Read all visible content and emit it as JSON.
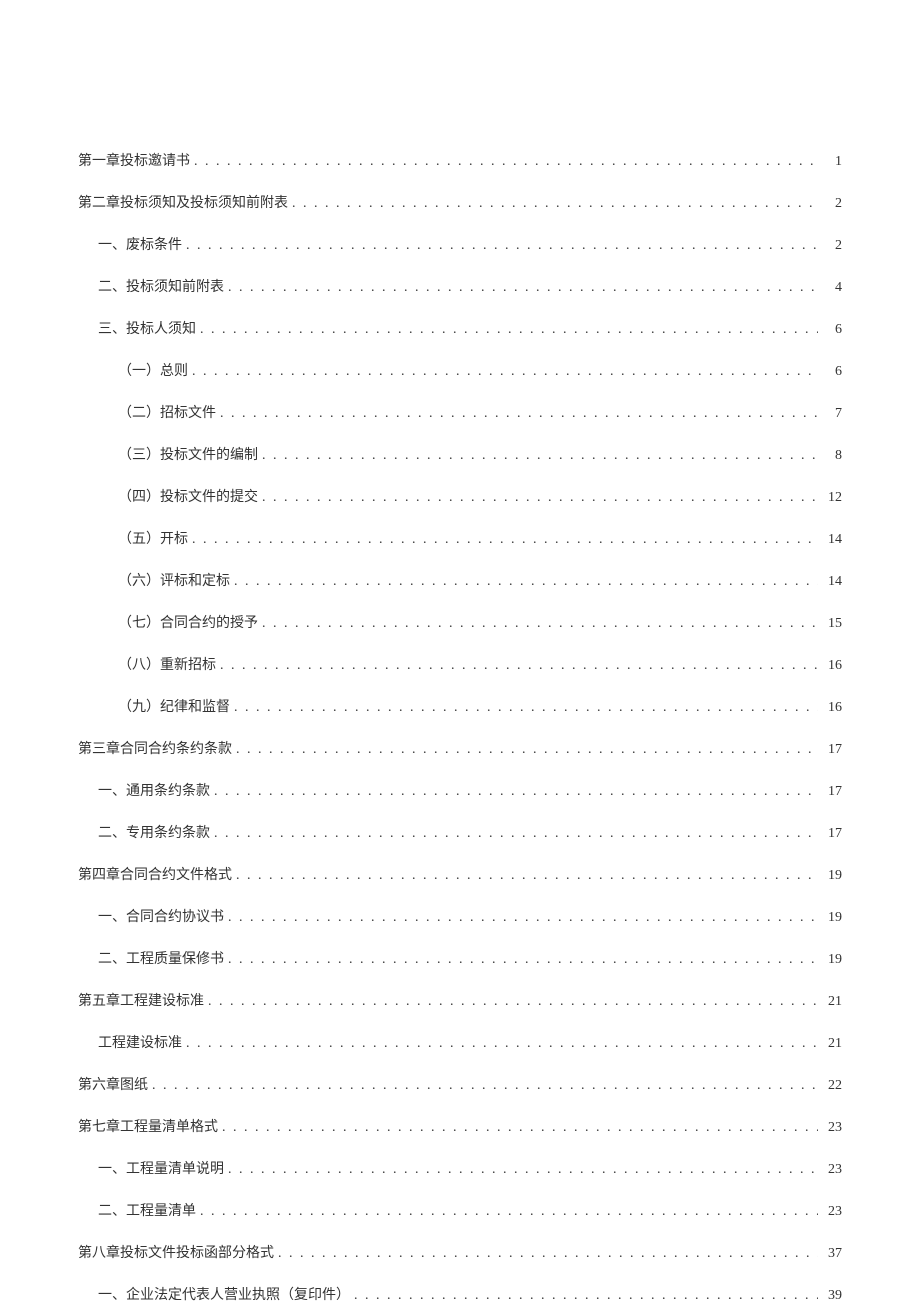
{
  "toc": [
    {
      "title": "第一章投标邀请书",
      "page": "1",
      "level": 0
    },
    {
      "title": "第二章投标须知及投标须知前附表",
      "page": "2",
      "level": 0
    },
    {
      "title": "一、废标条件",
      "page": "2",
      "level": 1
    },
    {
      "title": "二、投标须知前附表",
      "page": "4",
      "level": 1
    },
    {
      "title": "三、投标人须知",
      "page": "6",
      "level": 1
    },
    {
      "title": "（一）总则",
      "page": "6",
      "level": 2
    },
    {
      "title": "（二）招标文件",
      "page": "7",
      "level": 2
    },
    {
      "title": "（三）投标文件的编制",
      "page": "8",
      "level": 2
    },
    {
      "title": "（四）投标文件的提交",
      "page": "12",
      "level": 2
    },
    {
      "title": "（五）开标",
      "page": "14",
      "level": 2
    },
    {
      "title": "（六）评标和定标",
      "page": "14",
      "level": 2
    },
    {
      "title": "（七）合同合约的授予",
      "page": "15",
      "level": 2
    },
    {
      "title": "（八）重新招标",
      "page": "16",
      "level": 2
    },
    {
      "title": "（九）纪律和监督",
      "page": "16",
      "level": 2
    },
    {
      "title": "第三章合同合约条约条款",
      "page": "17",
      "level": 0
    },
    {
      "title": "一、通用条约条款",
      "page": "17",
      "level": 1
    },
    {
      "title": "二、专用条约条款",
      "page": "17",
      "level": 1
    },
    {
      "title": "第四章合同合约文件格式",
      "page": "19",
      "level": 0
    },
    {
      "title": "一、合同合约协议书",
      "page": "19",
      "level": 1
    },
    {
      "title": "二、工程质量保修书",
      "page": "19",
      "level": 1
    },
    {
      "title": "第五章工程建设标准",
      "page": "21",
      "level": 0
    },
    {
      "title": "工程建设标准",
      "page": "21",
      "level": 1
    },
    {
      "title": "第六章图纸",
      "page": "22",
      "level": 0
    },
    {
      "title": "第七章工程量清单格式",
      "page": "23",
      "level": 0
    },
    {
      "title": "一、工程量清单说明",
      "page": "23",
      "level": 1
    },
    {
      "title": "二、工程量清单",
      "page": "23",
      "level": 1
    },
    {
      "title": "第八章投标文件投标函部分格式",
      "page": "37",
      "level": 0
    },
    {
      "title": "一、企业法定代表人营业执照（复印件）",
      "page": "39",
      "level": 1
    }
  ]
}
